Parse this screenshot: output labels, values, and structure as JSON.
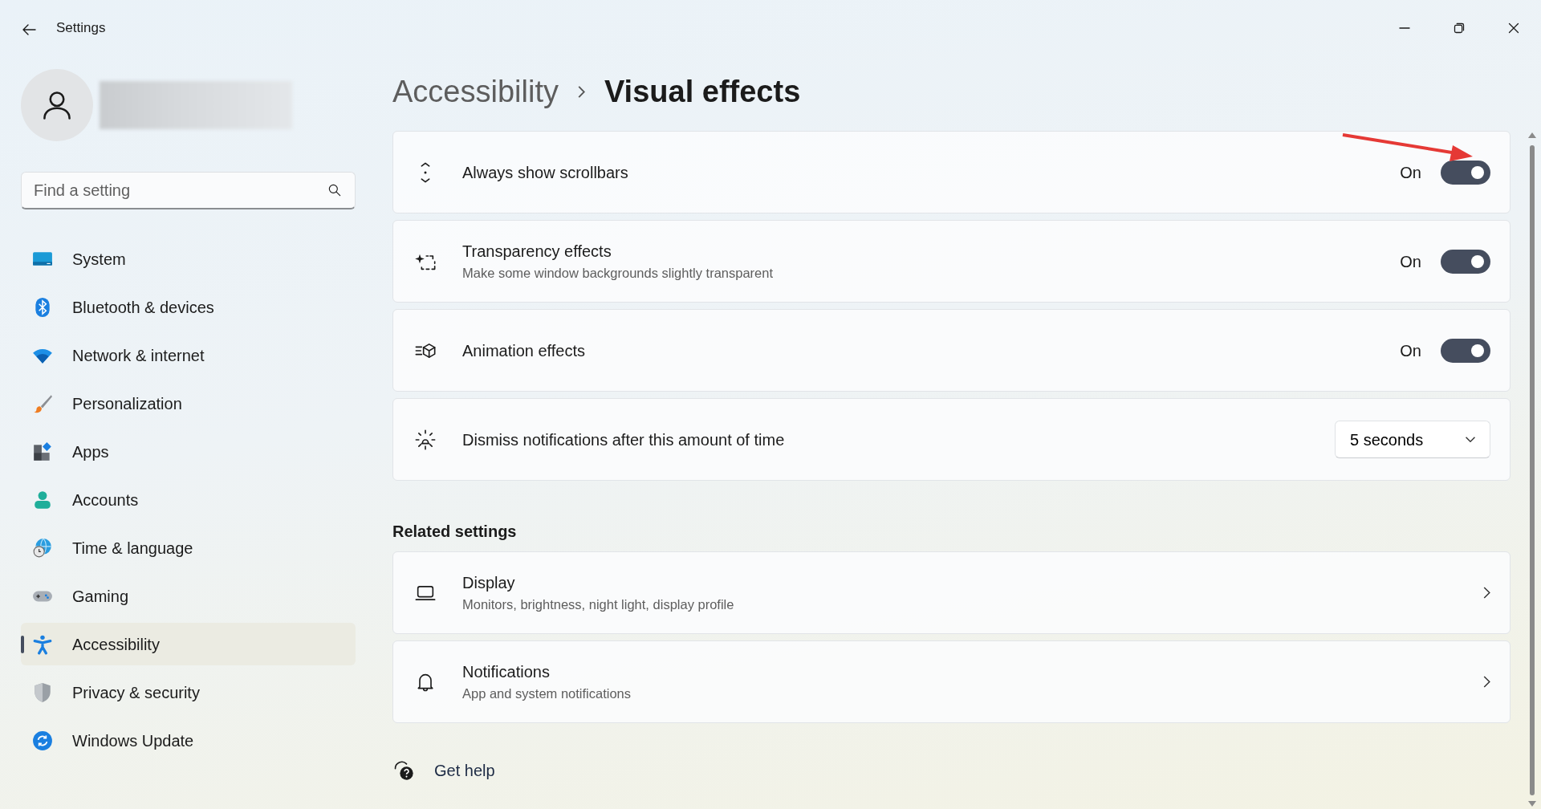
{
  "window": {
    "title": "Settings"
  },
  "search": {
    "placeholder": "Find a setting"
  },
  "sidebar": {
    "items": [
      {
        "label": "System",
        "selected": false
      },
      {
        "label": "Bluetooth & devices",
        "selected": false
      },
      {
        "label": "Network & internet",
        "selected": false
      },
      {
        "label": "Personalization",
        "selected": false
      },
      {
        "label": "Apps",
        "selected": false
      },
      {
        "label": "Accounts",
        "selected": false
      },
      {
        "label": "Time & language",
        "selected": false
      },
      {
        "label": "Gaming",
        "selected": false
      },
      {
        "label": "Accessibility",
        "selected": true
      },
      {
        "label": "Privacy & security",
        "selected": false
      },
      {
        "label": "Windows Update",
        "selected": false
      }
    ]
  },
  "breadcrumb": [
    {
      "label": "Accessibility",
      "current": false
    },
    {
      "label": "Visual effects",
      "current": true
    }
  ],
  "settings": [
    {
      "kind": "toggle",
      "title": "Always show scrollbars",
      "state_label": "On",
      "on": true
    },
    {
      "kind": "toggle",
      "title": "Transparency effects",
      "description": "Make some window backgrounds slightly transparent",
      "state_label": "On",
      "on": true
    },
    {
      "kind": "toggle",
      "title": "Animation effects",
      "state_label": "On",
      "on": true
    },
    {
      "kind": "dropdown",
      "title": "Dismiss notifications after this amount of time",
      "value": "5 seconds"
    }
  ],
  "related": {
    "heading": "Related settings",
    "items": [
      {
        "title": "Display",
        "description": "Monitors, brightness, night light, display profile"
      },
      {
        "title": "Notifications",
        "description": "App and system notifications"
      }
    ]
  },
  "help": {
    "label": "Get help"
  }
}
